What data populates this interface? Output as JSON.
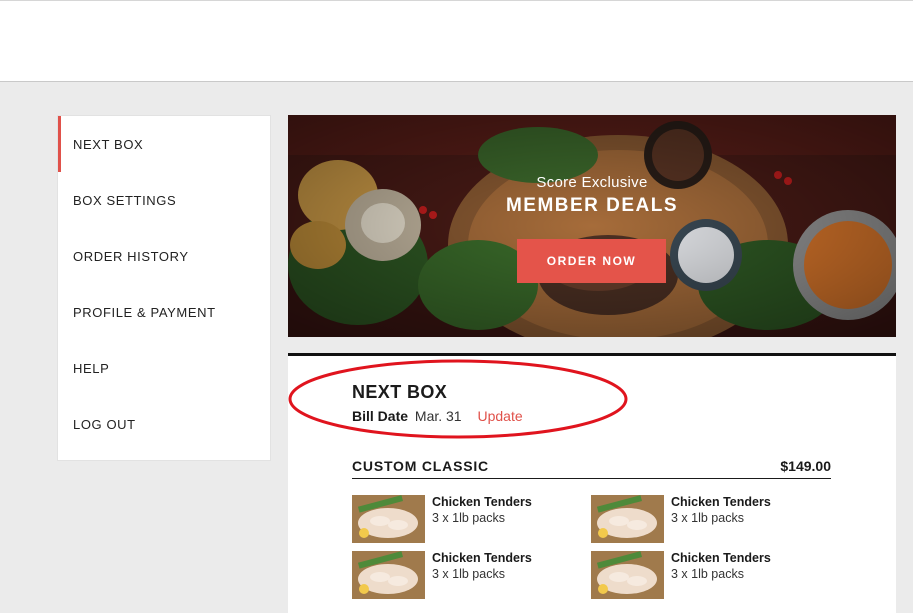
{
  "sidebar": {
    "items": [
      {
        "label": "NEXT BOX"
      },
      {
        "label": "BOX SETTINGS"
      },
      {
        "label": "ORDER HISTORY"
      },
      {
        "label": "PROFILE & PAYMENT"
      },
      {
        "label": "HELP"
      },
      {
        "label": "LOG OUT"
      }
    ],
    "accent_color": "#e0514a"
  },
  "banner": {
    "subtitle": "Score Exclusive",
    "title": "MEMBER DEALS",
    "button_label": "ORDER NOW",
    "button_color": "#e4544a"
  },
  "next_box": {
    "title": "NEXT BOX",
    "bill_label": "Bill Date",
    "bill_date": "Mar. 31",
    "update_label": "Update",
    "highlight_color": "#e0141e",
    "plan": {
      "name": "CUSTOM CLASSIC",
      "price": "$149.00"
    },
    "products": [
      {
        "name": "Chicken Tenders",
        "qty": "3 x 1lb packs"
      },
      {
        "name": "Chicken Tenders",
        "qty": "3 x 1lb packs"
      },
      {
        "name": "Chicken Tenders",
        "qty": "3 x 1lb packs"
      },
      {
        "name": "Chicken Tenders",
        "qty": "3 x 1lb packs"
      }
    ]
  }
}
